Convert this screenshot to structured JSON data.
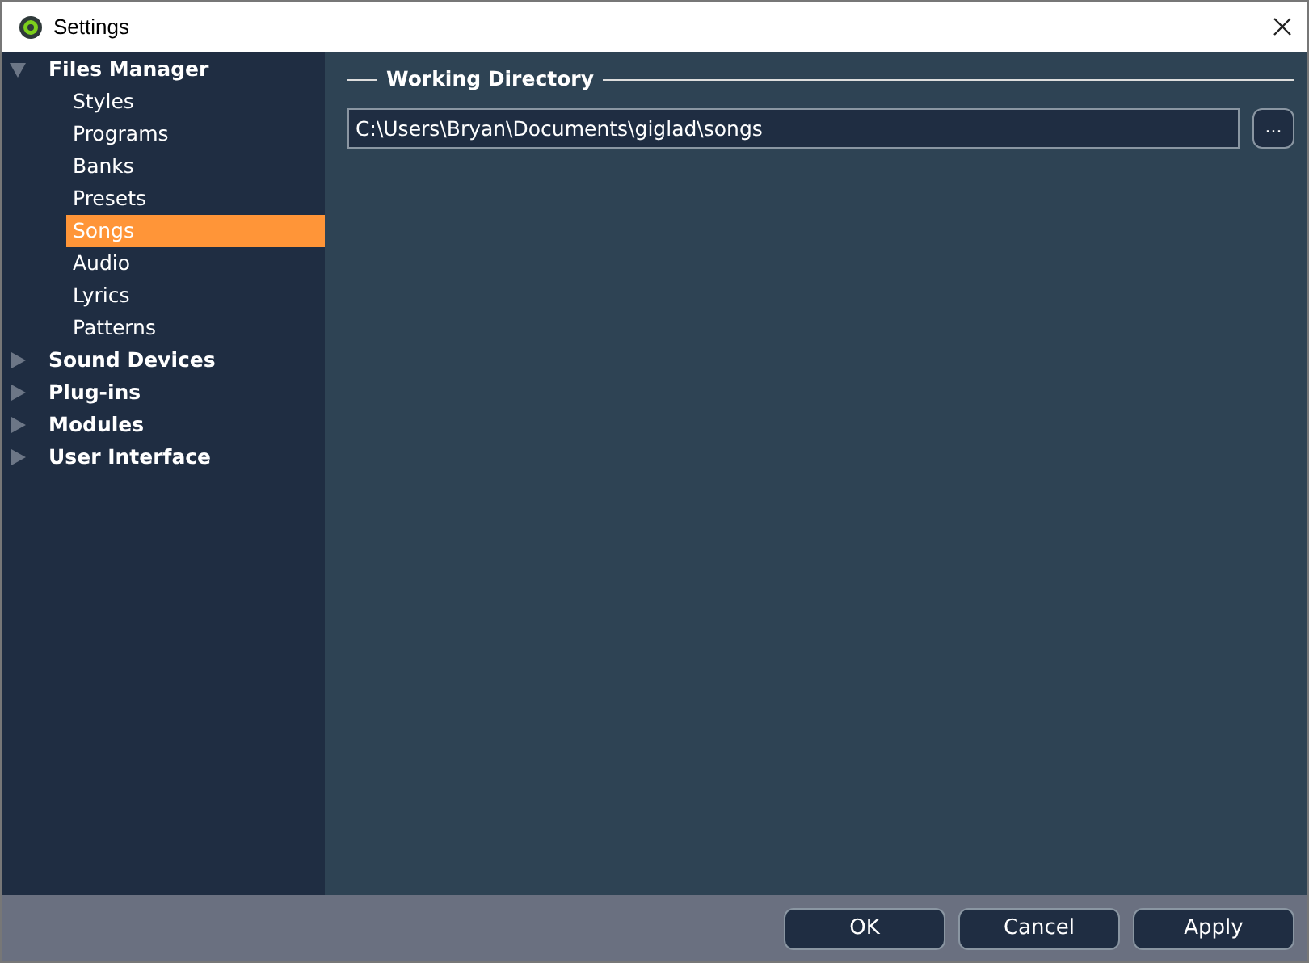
{
  "window": {
    "title": "Settings"
  },
  "sidebar": {
    "items": [
      {
        "label": "Files Manager",
        "expanded": true,
        "selected": false,
        "children": [
          {
            "label": "Styles",
            "selected": false
          },
          {
            "label": "Programs",
            "selected": false
          },
          {
            "label": "Banks",
            "selected": false
          },
          {
            "label": "Presets",
            "selected": false
          },
          {
            "label": "Songs",
            "selected": true
          },
          {
            "label": "Audio",
            "selected": false
          },
          {
            "label": "Lyrics",
            "selected": false
          },
          {
            "label": "Patterns",
            "selected": false
          }
        ]
      },
      {
        "label": "Sound Devices",
        "expanded": false,
        "selected": false
      },
      {
        "label": "Plug-ins",
        "expanded": false,
        "selected": false
      },
      {
        "label": "Modules",
        "expanded": false,
        "selected": false
      },
      {
        "label": "User Interface",
        "expanded": false,
        "selected": false
      }
    ]
  },
  "working_directory": {
    "title": "Working Directory",
    "value": "C:\\Users\\Bryan\\Documents\\giglad\\songs",
    "browse_button": "..."
  },
  "buttons": [
    "OK",
    "Cancel",
    "Apply"
  ]
}
